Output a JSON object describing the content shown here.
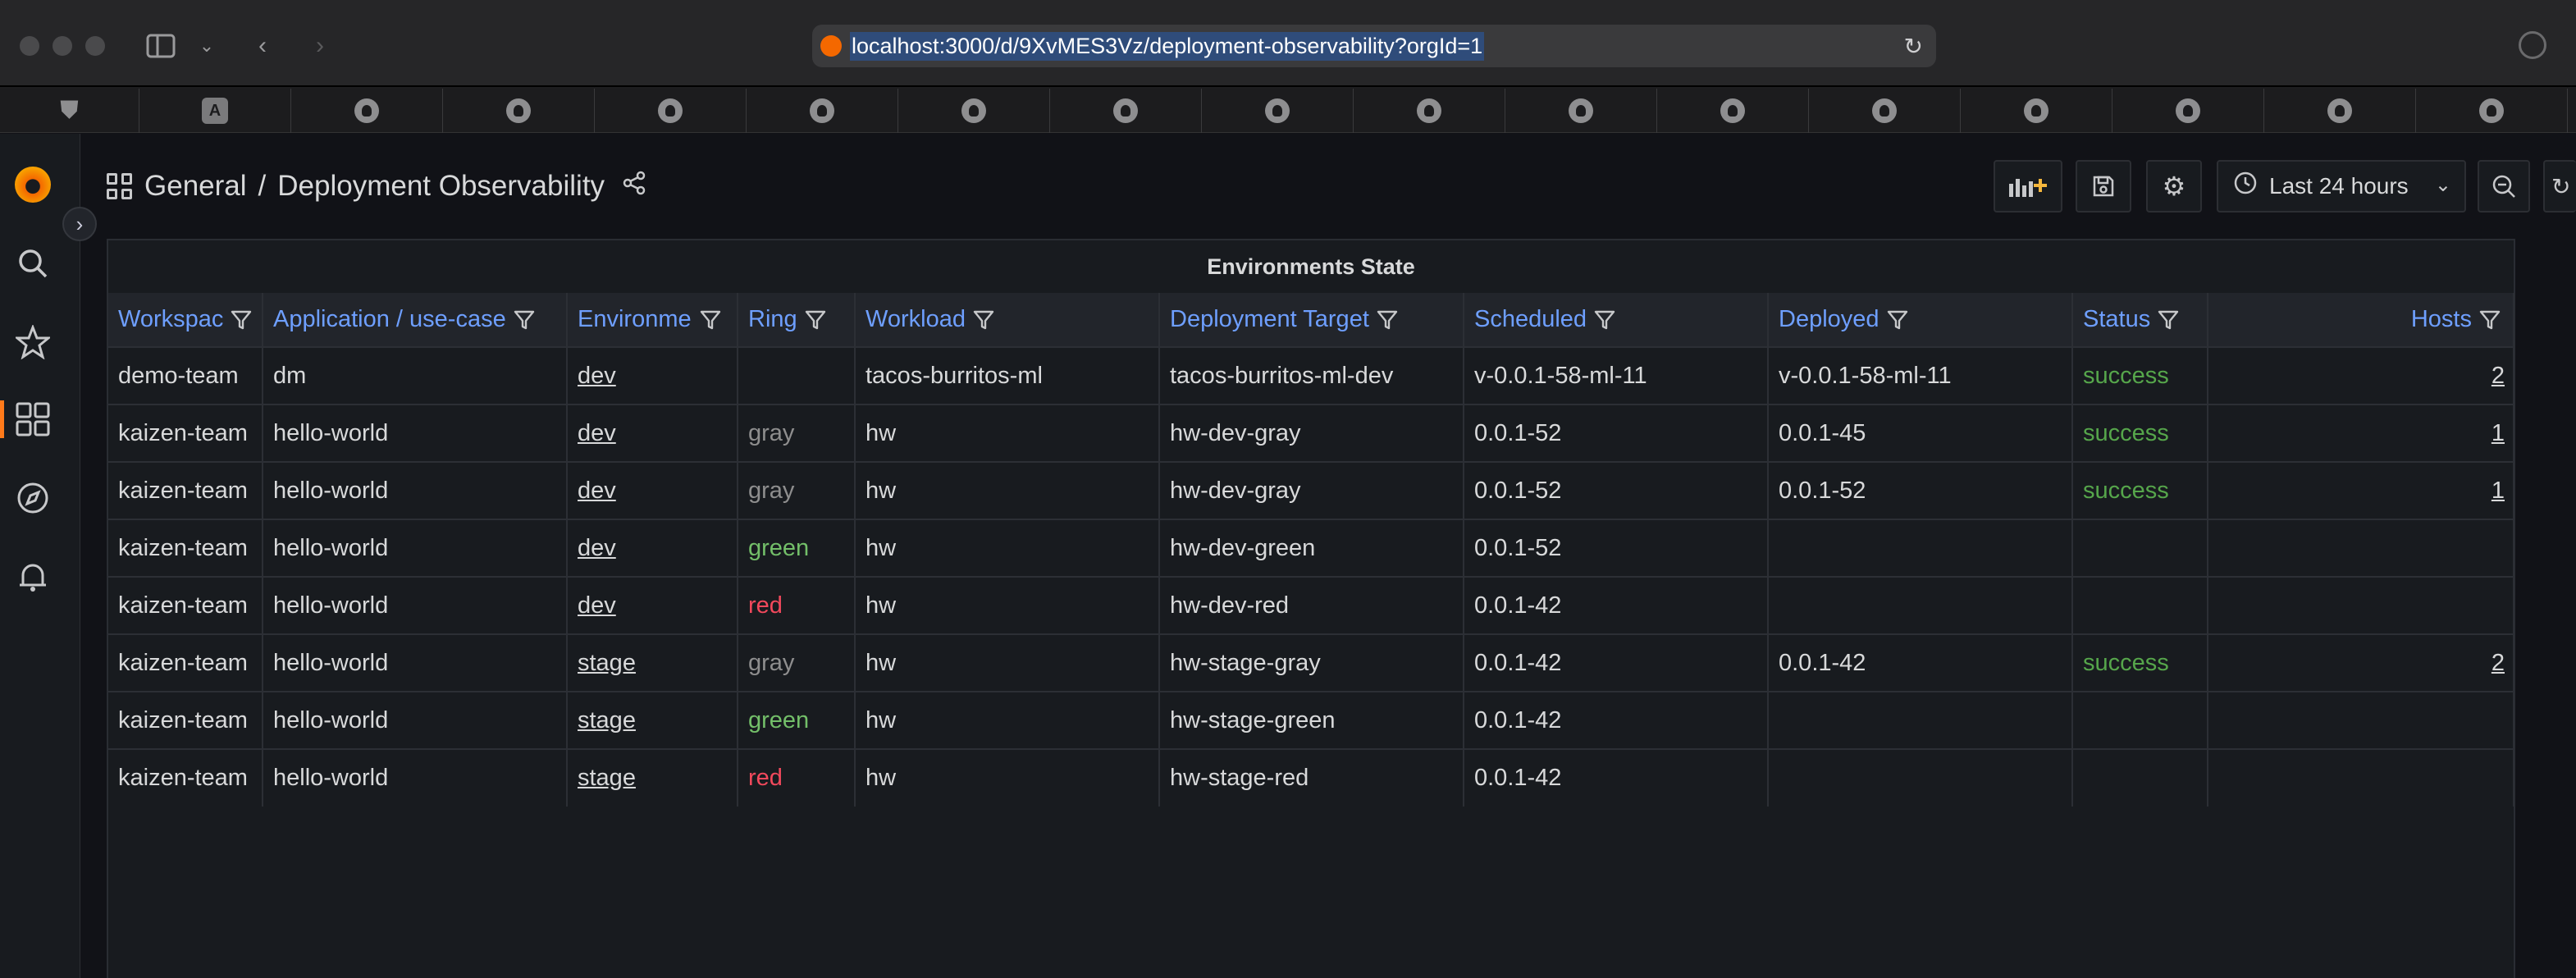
{
  "browser": {
    "url": "localhost:3000/d/9XvMES3Vz/deployment-observability?orgId=1",
    "bookmark_icons": [
      "shield-icon",
      "a-icon",
      "github-icon",
      "github-alt-icon",
      "github-icon",
      "github-alt-icon",
      "github-icon",
      "github-icon",
      "github-icon",
      "github-icon",
      "github-icon",
      "github-icon",
      "github-icon",
      "github-icon",
      "github-icon",
      "github-icon",
      "github-icon"
    ]
  },
  "breadcrumb": {
    "folder": "General",
    "separator": "/",
    "dashboard": "Deployment Observability"
  },
  "toolbar": {
    "time_range": "Last 24 hours"
  },
  "panel": {
    "title": "Environments State",
    "columns": [
      "Workspac",
      "Application / use-case",
      "Environmer",
      "Ring",
      "Workload",
      "Deployment Target",
      "Scheduled",
      "Deployed",
      "Status",
      "Hosts"
    ],
    "rows": [
      {
        "workspace": "demo-team",
        "application": "dm",
        "environment": "dev",
        "ring": "",
        "ring_color": "",
        "workload": "tacos-burritos-ml",
        "target": "tacos-burritos-ml-dev",
        "scheduled": "v-0.0.1-58-ml-11",
        "deployed": "v-0.0.1-58-ml-11",
        "status": "success",
        "hosts": "2"
      },
      {
        "workspace": "kaizen-team",
        "application": "hello-world",
        "environment": "dev",
        "ring": "gray",
        "ring_color": "gray",
        "workload": "hw",
        "target": "hw-dev-gray",
        "scheduled": "0.0.1-52",
        "deployed": "0.0.1-45",
        "status": "success",
        "hosts": "1"
      },
      {
        "workspace": "kaizen-team",
        "application": "hello-world",
        "environment": "dev",
        "ring": "gray",
        "ring_color": "gray",
        "workload": "hw",
        "target": "hw-dev-gray",
        "scheduled": "0.0.1-52",
        "deployed": "0.0.1-52",
        "status": "success",
        "hosts": "1"
      },
      {
        "workspace": "kaizen-team",
        "application": "hello-world",
        "environment": "dev",
        "ring": "green",
        "ring_color": "green",
        "workload": "hw",
        "target": "hw-dev-green",
        "scheduled": "0.0.1-52",
        "deployed": "",
        "status": "",
        "hosts": ""
      },
      {
        "workspace": "kaizen-team",
        "application": "hello-world",
        "environment": "dev",
        "ring": "red",
        "ring_color": "red",
        "workload": "hw",
        "target": "hw-dev-red",
        "scheduled": "0.0.1-42",
        "deployed": "",
        "status": "",
        "hosts": ""
      },
      {
        "workspace": "kaizen-team",
        "application": "hello-world",
        "environment": "stage",
        "ring": "gray",
        "ring_color": "gray",
        "workload": "hw",
        "target": "hw-stage-gray",
        "scheduled": "0.0.1-42",
        "deployed": "0.0.1-42",
        "status": "success",
        "hosts": "2"
      },
      {
        "workspace": "kaizen-team",
        "application": "hello-world",
        "environment": "stage",
        "ring": "green",
        "ring_color": "green",
        "workload": "hw",
        "target": "hw-stage-green",
        "scheduled": "0.0.1-42",
        "deployed": "",
        "status": "",
        "hosts": ""
      },
      {
        "workspace": "kaizen-team",
        "application": "hello-world",
        "environment": "stage",
        "ring": "red",
        "ring_color": "red",
        "workload": "hw",
        "target": "hw-stage-red",
        "scheduled": "0.0.1-42",
        "deployed": "",
        "status": "",
        "hosts": ""
      }
    ]
  },
  "colors": {
    "header_text": "#6e9fff",
    "ring_gray": "#8e8e8e",
    "ring_green": "#73bf69",
    "ring_red": "#f2495c",
    "status_success": "#56a64b",
    "grafana_orange": "#f46800"
  }
}
